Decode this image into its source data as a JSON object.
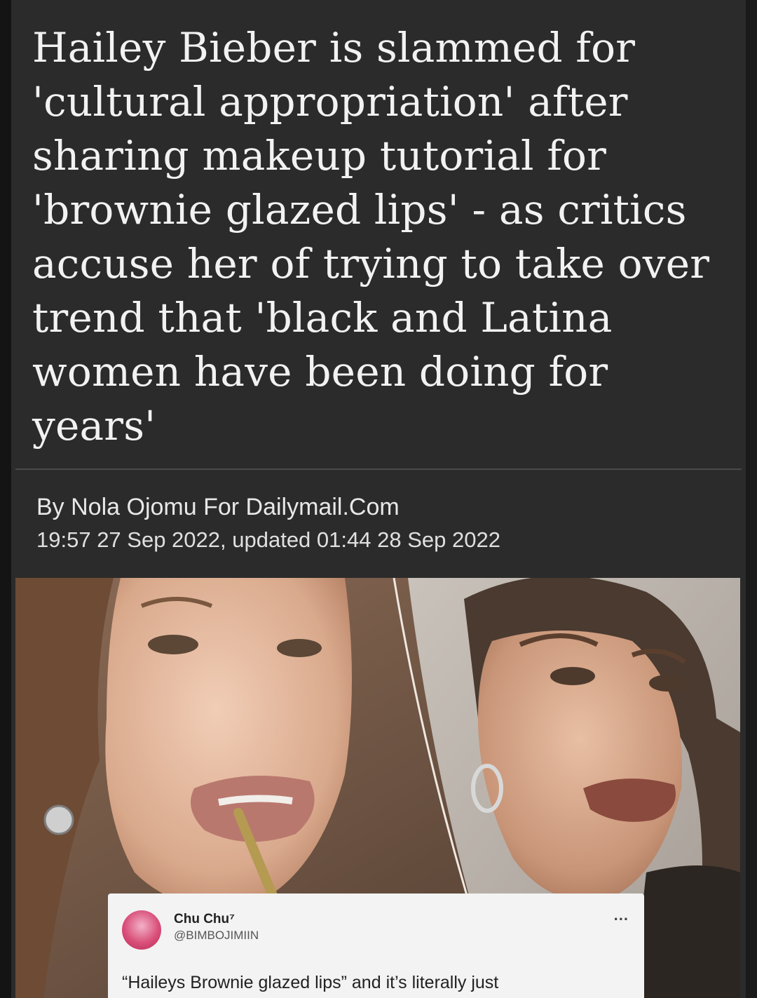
{
  "article": {
    "headline": "Hailey Bieber is slammed for 'cultural appropriation' after sharing makeup tutorial for 'brownie glazed lips' - as critics accuse her of trying to take over trend that 'black and Latina women have been doing for years'",
    "byline": "By Nola Ojomu For Dailymail.Com",
    "dateline": "19:57 27 Sep 2022, updated 01:44 28 Sep 2022"
  },
  "tweet": {
    "name": "Chu Chu⁷",
    "handle": "@BIMBOJIMIIN",
    "more_label": "...",
    "text": "“Haileys Brownie glazed lips”  and it’s literally just"
  },
  "colors": {
    "background": "#2b2b2b",
    "headline": "#f2f2f2",
    "meta_text": "#e8e8e8",
    "divider": "#4a4a4a"
  }
}
